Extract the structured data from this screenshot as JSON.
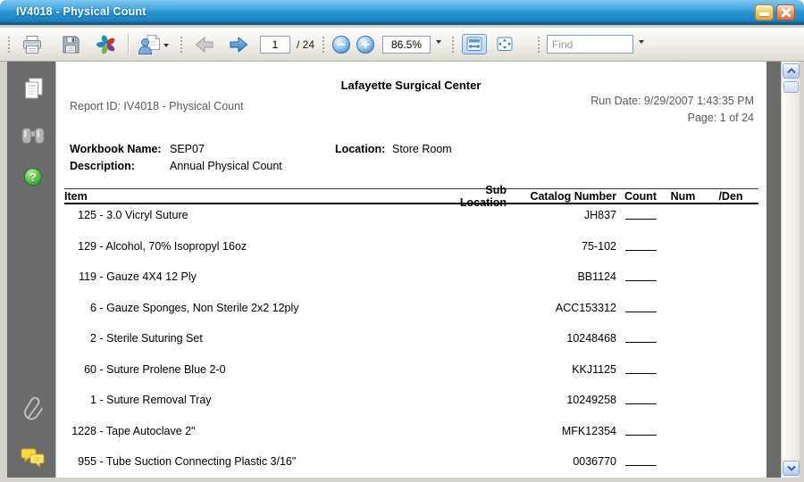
{
  "window": {
    "title": "IV4018 - Physical Count"
  },
  "toolbar": {
    "page_number": "1",
    "page_count_label": "/ 24",
    "zoom_level": "86.5%",
    "find_placeholder": "Find",
    "icons": [
      "print-icon",
      "save-icon",
      "refresh-icon",
      "export-icon",
      "dropdown-icon",
      "prev-page-icon",
      "next-page-icon",
      "zoom-out-icon",
      "zoom-in-icon",
      "fit-width-icon",
      "fit-page-icon"
    ]
  },
  "sidebar": {
    "icons": [
      "pages-icon",
      "binoculars-icon",
      "help-icon",
      "paperclip-icon",
      "comments-icon"
    ]
  },
  "glyphs": {
    "help": "?"
  },
  "report": {
    "title": "Lafayette Surgical Center",
    "report_id": "Report ID: IV4018 - Physical Count",
    "run_date": "Run Date: 9/29/2007 1:43:35 PM",
    "page_label": "Page: 1 of 24",
    "workbook_name_label": "Workbook Name:",
    "workbook_name": "SEP07",
    "location_label": "Location:",
    "location": "Store Room",
    "description_label": "Description:",
    "description": "Annual Physical Count",
    "table": {
      "columns": [
        "Item",
        "Sub Location",
        "Catalog Number",
        "Count",
        "Num",
        "/Den"
      ],
      "item_separator": " - ",
      "rows": [
        {
          "qty": "125",
          "name": "3.0 Vicryl Suture",
          "catalog": "JH837"
        },
        {
          "qty": "129",
          "name": "Alcohol, 70% Isopropyl 16oz",
          "catalog": "75-102"
        },
        {
          "qty": "119",
          "name": "Gauze 4X4 12 Ply",
          "catalog": "BB1124"
        },
        {
          "qty": "6",
          "name": "Gauze Sponges, Non Sterile 2x2 12ply",
          "catalog": "ACC153312"
        },
        {
          "qty": "2",
          "name": "Sterile Suturing Set",
          "catalog": "10248468"
        },
        {
          "qty": "60",
          "name": "Suture Prolene Blue 2-0",
          "catalog": "KKJ1125"
        },
        {
          "qty": "1",
          "name": "Suture Removal Tray",
          "catalog": "10249258"
        },
        {
          "qty": "1228",
          "name": "Tape Autoclave 2\"",
          "catalog": "MFK12354"
        },
        {
          "qty": "955",
          "name": "Tube Suction Connecting Plastic 3/16\"",
          "catalog": "0036770"
        }
      ]
    }
  },
  "colors": {
    "titlebar_blue": "#2793d1",
    "selected_tool_bg": "#bcd7f2",
    "minimize_yellow": "#f3cf6e",
    "close_orange": "#d2703c",
    "help_green": "#3aa33a",
    "comments_yellow": "#ffd83d",
    "accent_blue": "#3d87c8"
  }
}
